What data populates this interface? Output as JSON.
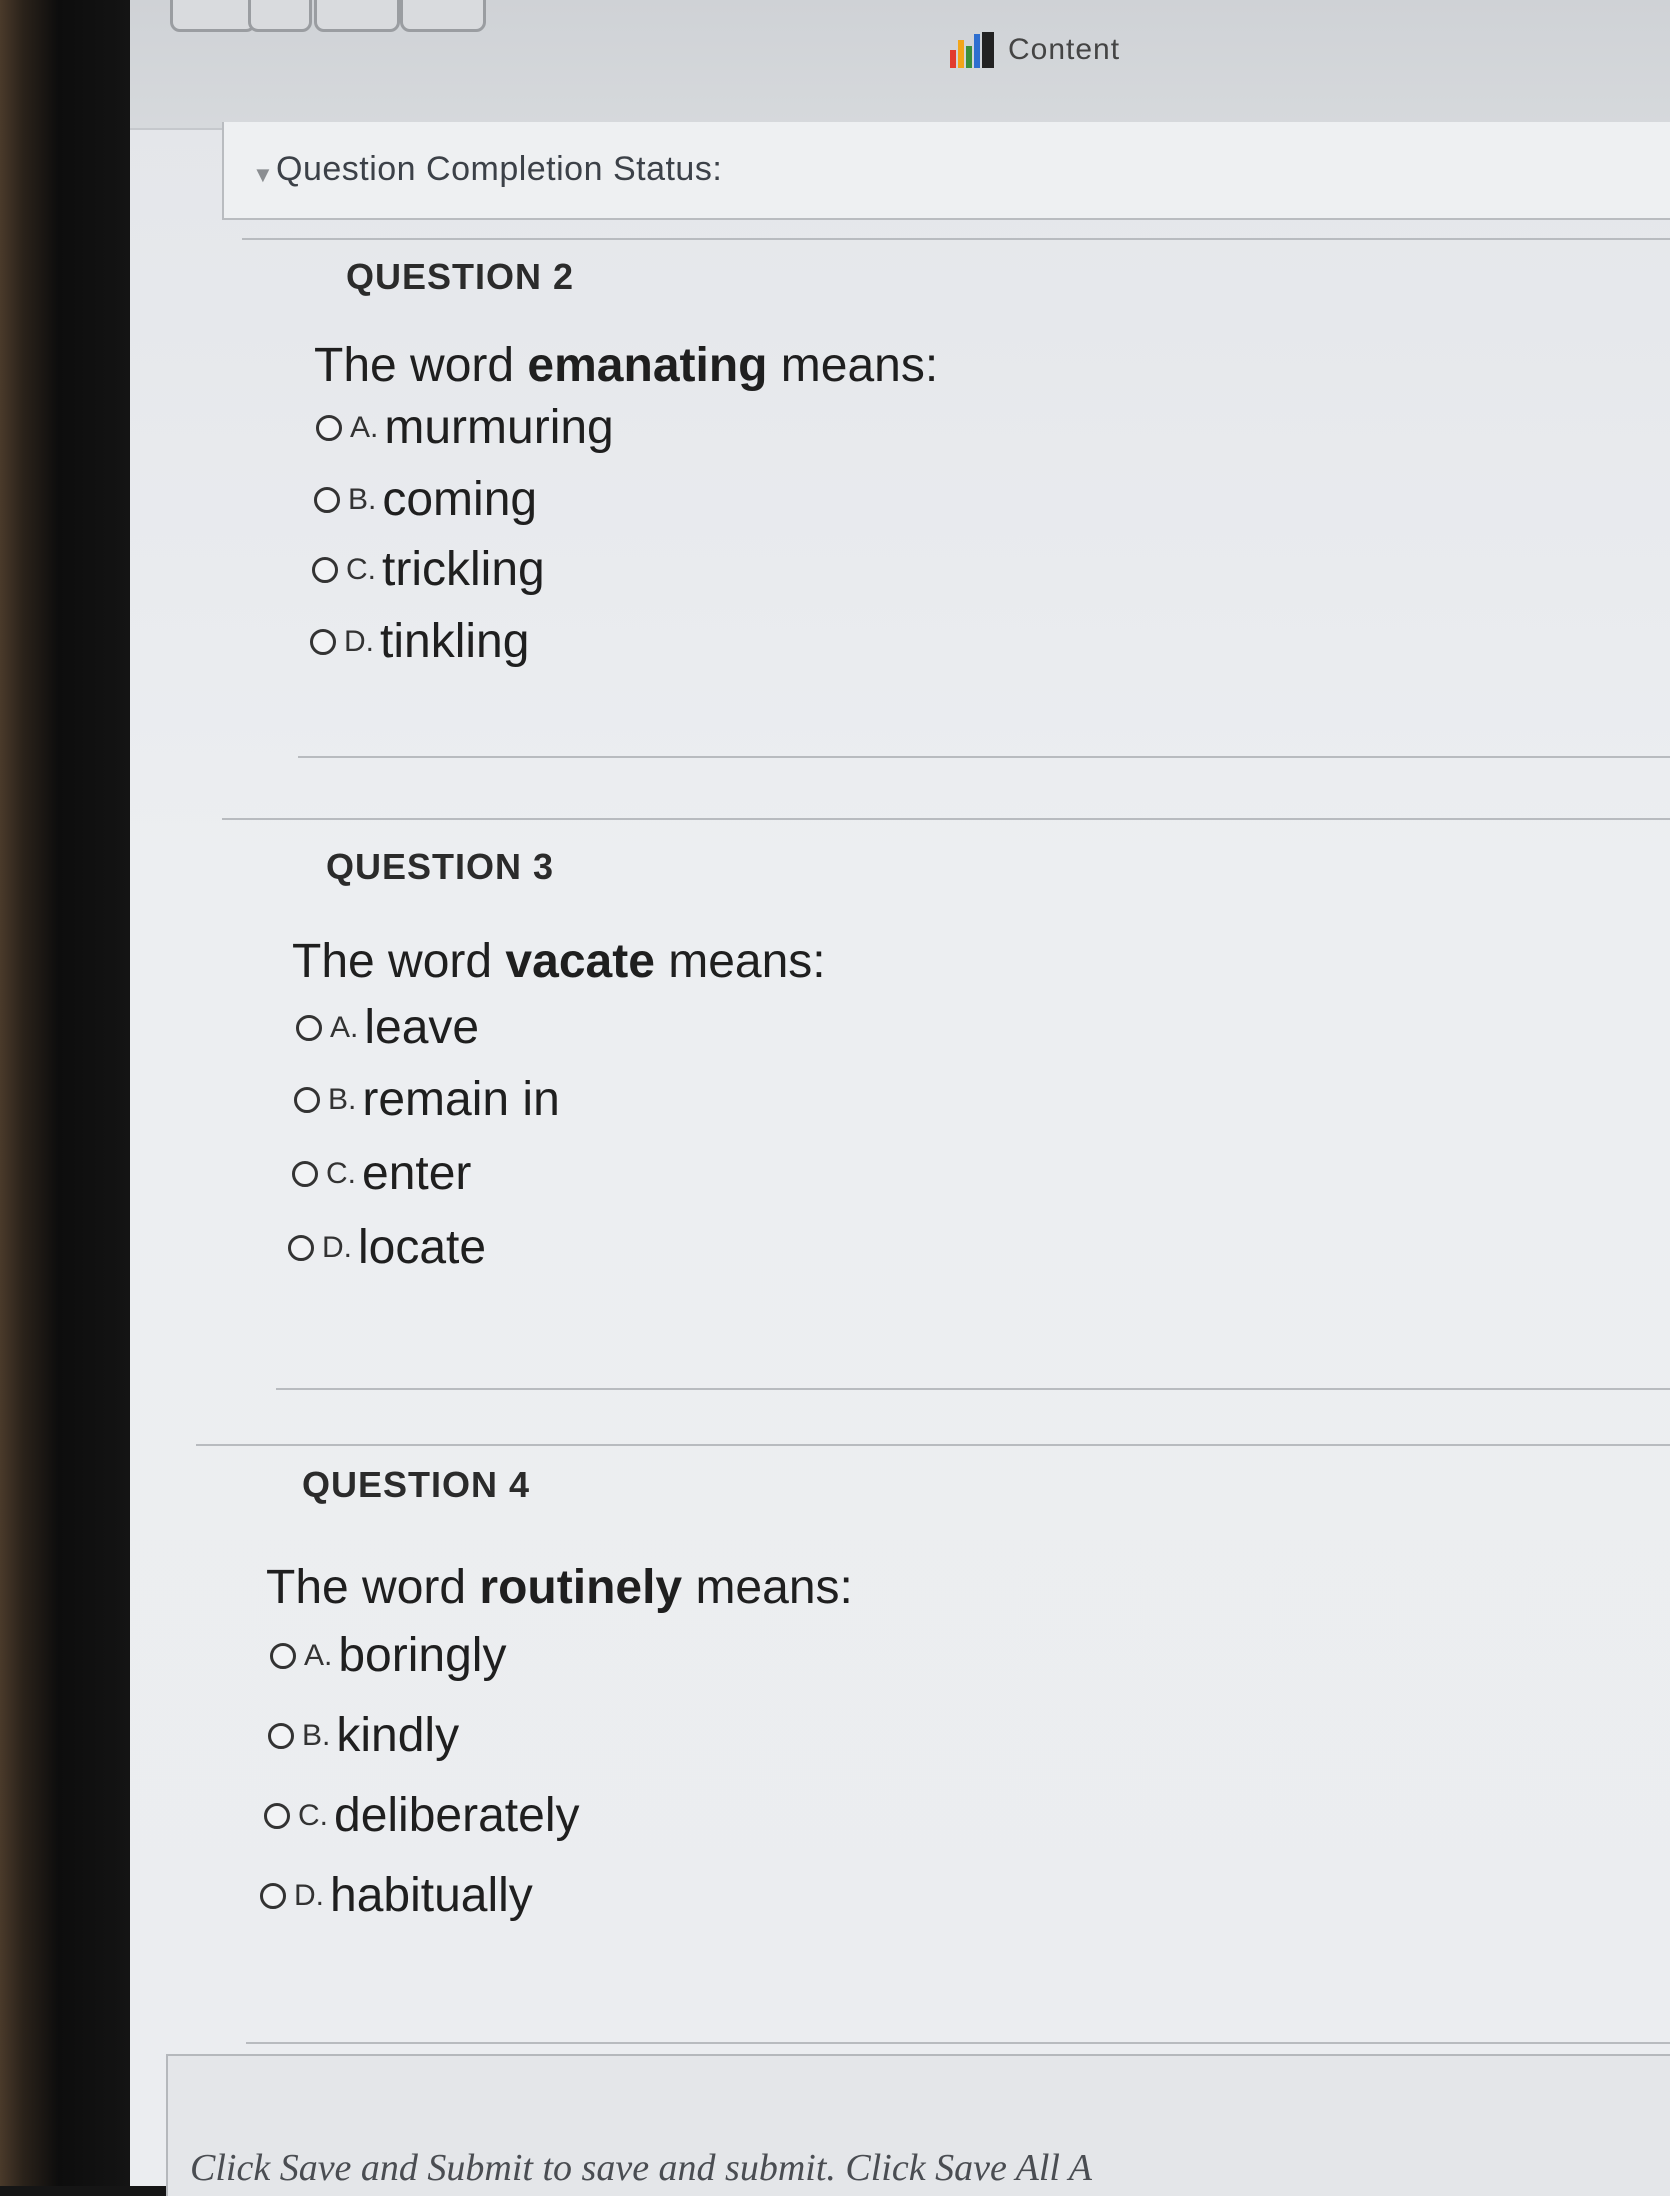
{
  "tab": {
    "label": "Content",
    "icon": "content-bars-icon"
  },
  "status": {
    "label": "Question Completion Status:"
  },
  "questions": [
    {
      "title": "QUESTION 2",
      "prompt_pre": "The word ",
      "prompt_word": "emanating",
      "prompt_post": " means:",
      "options": [
        {
          "letter": "A.",
          "text": "murmuring"
        },
        {
          "letter": "B.",
          "text": "coming"
        },
        {
          "letter": "C.",
          "text": "trickling"
        },
        {
          "letter": "D.",
          "text": "tinkling"
        }
      ]
    },
    {
      "title": "QUESTION 3",
      "prompt_pre": "The word ",
      "prompt_word": "vacate",
      "prompt_post": " means:",
      "options": [
        {
          "letter": "A.",
          "text": "leave"
        },
        {
          "letter": "B.",
          "text": "remain in"
        },
        {
          "letter": "C.",
          "text": "enter"
        },
        {
          "letter": "D.",
          "text": "locate"
        }
      ]
    },
    {
      "title": "QUESTION 4",
      "prompt_pre": "The word ",
      "prompt_word": "routinely",
      "prompt_post": " means:",
      "options": [
        {
          "letter": "A.",
          "text": "boringly"
        },
        {
          "letter": "B.",
          "text": "kindly"
        },
        {
          "letter": "C.",
          "text": "deliberately"
        },
        {
          "letter": "D.",
          "text": "habitually"
        }
      ]
    }
  ],
  "footer": {
    "text": "Click Save and Submit to save and submit. Click Save All A"
  },
  "colors": {
    "content_icon": [
      "#e23b2e",
      "#f2a51a",
      "#3a8f3c",
      "#2e6fd0",
      "#222222"
    ]
  }
}
